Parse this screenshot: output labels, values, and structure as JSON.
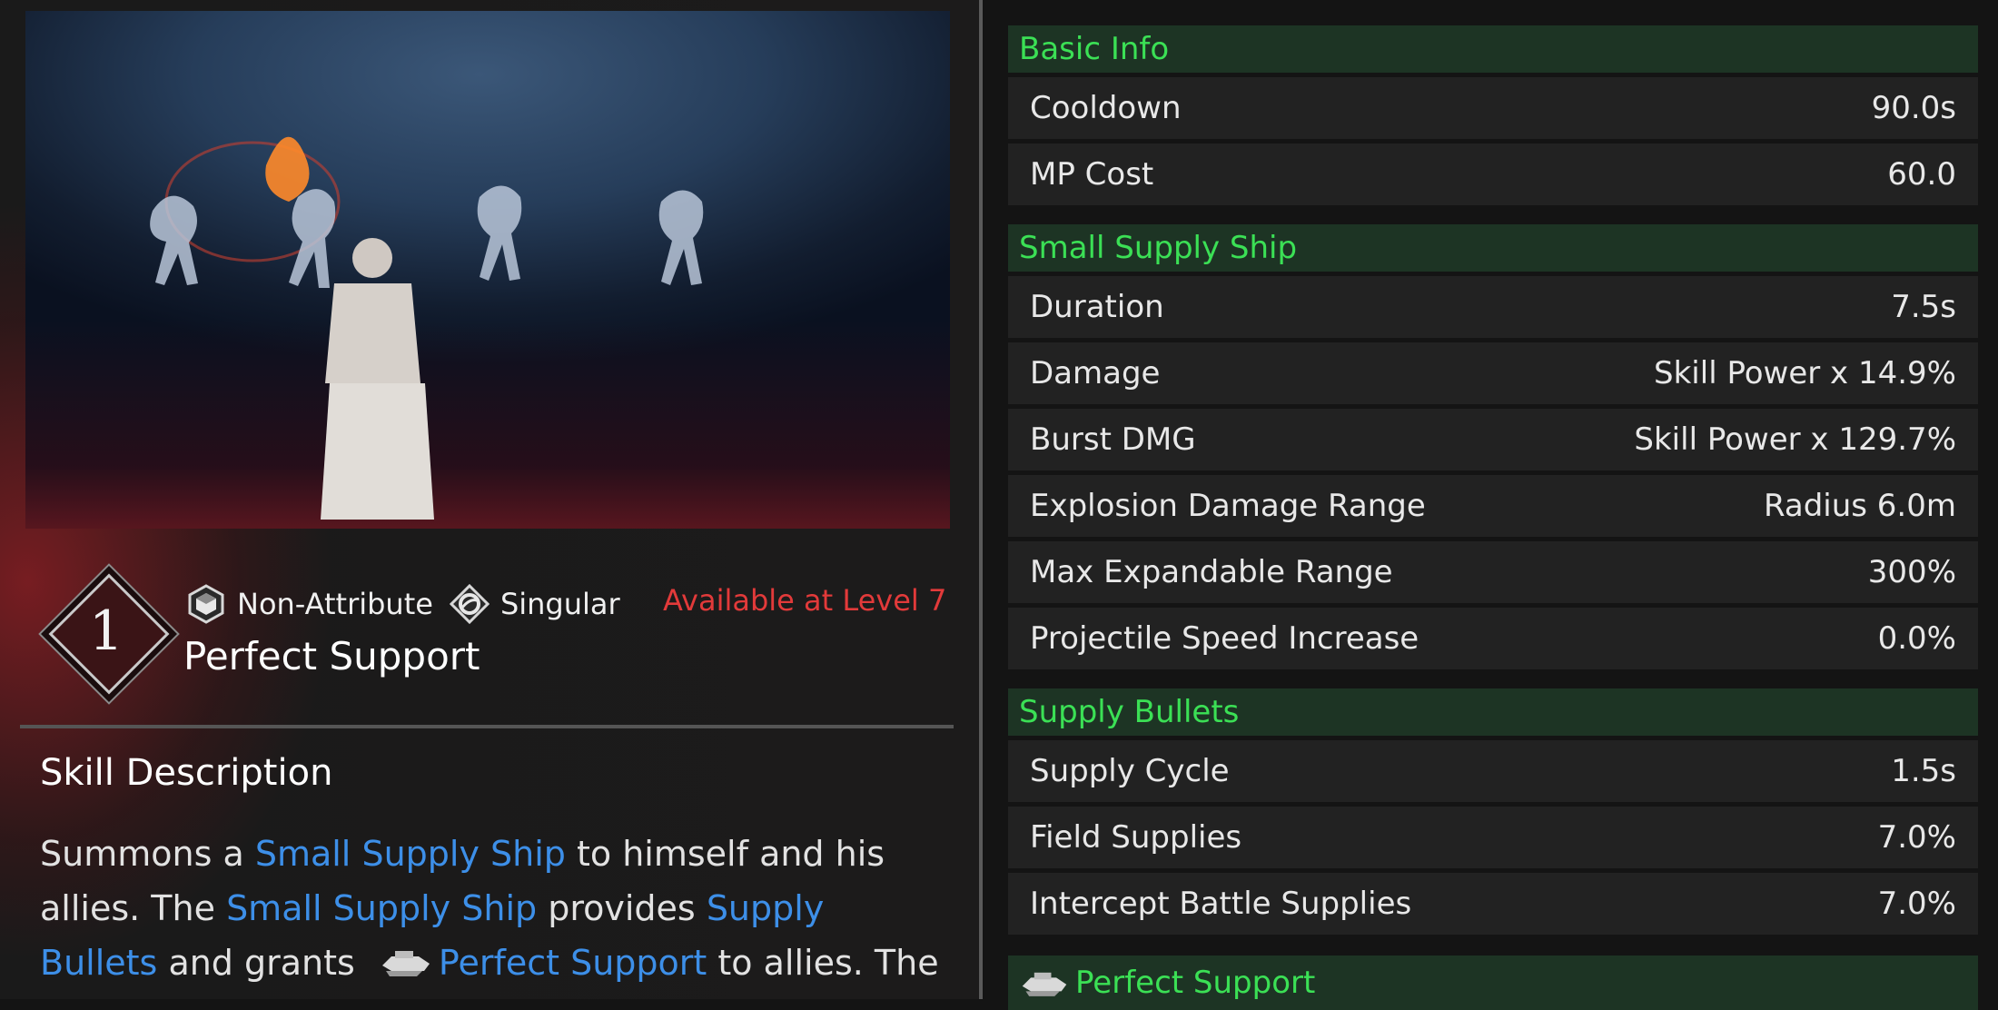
{
  "skill": {
    "rank": "1",
    "attribute": "Non-Attribute",
    "type": "Singular",
    "availability": "Available at Level 7",
    "name": "Perfect Support"
  },
  "description": {
    "title": "Skill Description",
    "segments": [
      {
        "text": "Summons a ",
        "keyword": false
      },
      {
        "text": "Small Supply Ship",
        "keyword": true
      },
      {
        "text": " to himself and his allies. The ",
        "keyword": false
      },
      {
        "text": "Small Supply Ship",
        "keyword": true
      },
      {
        "text": " provides ",
        "keyword": false
      },
      {
        "text": "Supply Bullets",
        "keyword": true
      },
      {
        "text": " and grants ",
        "keyword": false
      },
      {
        "text": "Perfect Support",
        "keyword": true,
        "icon": "supply-ship-icon"
      },
      {
        "text": " to allies. The",
        "keyword": false
      }
    ]
  },
  "stats": {
    "basic": {
      "title": "Basic Info",
      "rows": [
        {
          "label": "Cooldown",
          "value": "90.0s"
        },
        {
          "label": "MP Cost",
          "value": "60.0"
        }
      ]
    },
    "ship": {
      "title": "Small Supply Ship",
      "rows": [
        {
          "label": "Duration",
          "value": "7.5s"
        },
        {
          "label": "Damage",
          "value": "Skill Power x 14.9%"
        },
        {
          "label": "Burst DMG",
          "value": "Skill Power x 129.7%"
        },
        {
          "label": "Explosion Damage Range",
          "value": "Radius 6.0m"
        },
        {
          "label": "Max Expandable Range",
          "value": "300%"
        },
        {
          "label": "Projectile Speed Increase",
          "value": "0.0%"
        }
      ]
    },
    "bullets": {
      "title": "Supply Bullets",
      "rows": [
        {
          "label": "Supply Cycle",
          "value": "1.5s"
        },
        {
          "label": "Field Supplies",
          "value": "7.0%"
        },
        {
          "label": "Intercept Battle Supplies",
          "value": "7.0%"
        }
      ]
    },
    "perfect": {
      "title": "Perfect Support",
      "icon": "supply-ship-icon"
    }
  },
  "colors": {
    "section_header_text": "#3be055",
    "section_header_bg": "#1d3424",
    "keyword": "#3d8fe8",
    "availability": "#e23a3a"
  }
}
